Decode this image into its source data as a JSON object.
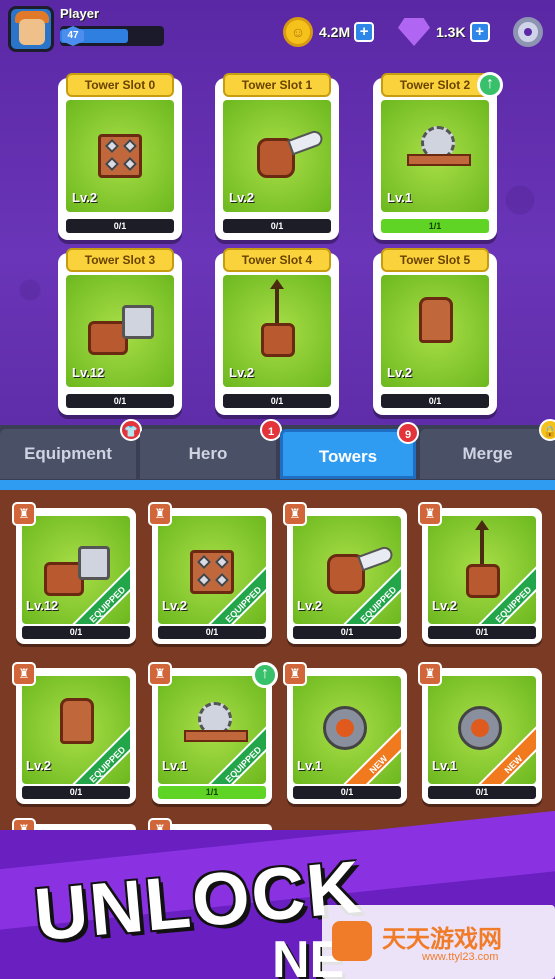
{
  "header": {
    "player_name": "Player",
    "level": "47",
    "level_progress": 0.65,
    "coins": "4.2M",
    "gems": "1.3K"
  },
  "slots": [
    {
      "title": "Tower Slot 0",
      "level": "Lv.2",
      "progress": "0/1",
      "art": "spikes"
    },
    {
      "title": "Tower Slot 1",
      "level": "Lv.2",
      "progress": "0/1",
      "art": "blade"
    },
    {
      "title": "Tower Slot 2",
      "level": "Lv.1",
      "progress": "1/1",
      "art": "saw",
      "upgrade": true
    },
    {
      "title": "Tower Slot 3",
      "level": "Lv.12",
      "progress": "0/1",
      "art": "hammer"
    },
    {
      "title": "Tower Slot 4",
      "level": "Lv.2",
      "progress": "0/1",
      "art": "crossbow"
    },
    {
      "title": "Tower Slot 5",
      "level": "Lv.2",
      "progress": "0/1",
      "art": "mortar"
    }
  ],
  "tabs": [
    {
      "label": "Equipment",
      "badge": "shirt-icon"
    },
    {
      "label": "Hero",
      "badge": "1"
    },
    {
      "label": "Towers",
      "badge": "9",
      "active": true
    },
    {
      "label": "Merge",
      "badge": "lock-icon"
    }
  ],
  "inventory": [
    {
      "level": "Lv.12",
      "progress": "0/1",
      "ribbon": "EQUIPPED",
      "art": "hammer"
    },
    {
      "level": "Lv.2",
      "progress": "0/1",
      "ribbon": "EQUIPPED",
      "art": "spikes"
    },
    {
      "level": "Lv.2",
      "progress": "0/1",
      "ribbon": "EQUIPPED",
      "art": "blade"
    },
    {
      "level": "Lv.2",
      "progress": "0/1",
      "ribbon": "EQUIPPED",
      "art": "crossbow"
    },
    {
      "level": "Lv.2",
      "progress": "0/1",
      "ribbon": "EQUIPPED",
      "art": "mortar"
    },
    {
      "level": "Lv.1",
      "progress": "1/1",
      "ribbon": "EQUIPPED",
      "art": "saw",
      "upgrade": true
    },
    {
      "level": "Lv.1",
      "progress": "0/1",
      "ribbon": "NEW",
      "art": "cannon"
    },
    {
      "level": "Lv.1",
      "progress": "0/1",
      "ribbon": "NEW",
      "art": "cannon"
    }
  ],
  "banner": {
    "headline": "UNLOCK",
    "subline": "NE"
  },
  "watermark": {
    "title": "天天游戏网",
    "url": "www.ttyl23.com"
  },
  "colors": {
    "purple": "#5b2aa6",
    "tab_active": "#2f9cf2",
    "panel": "#7a3a24",
    "green": "#6cb81e"
  }
}
